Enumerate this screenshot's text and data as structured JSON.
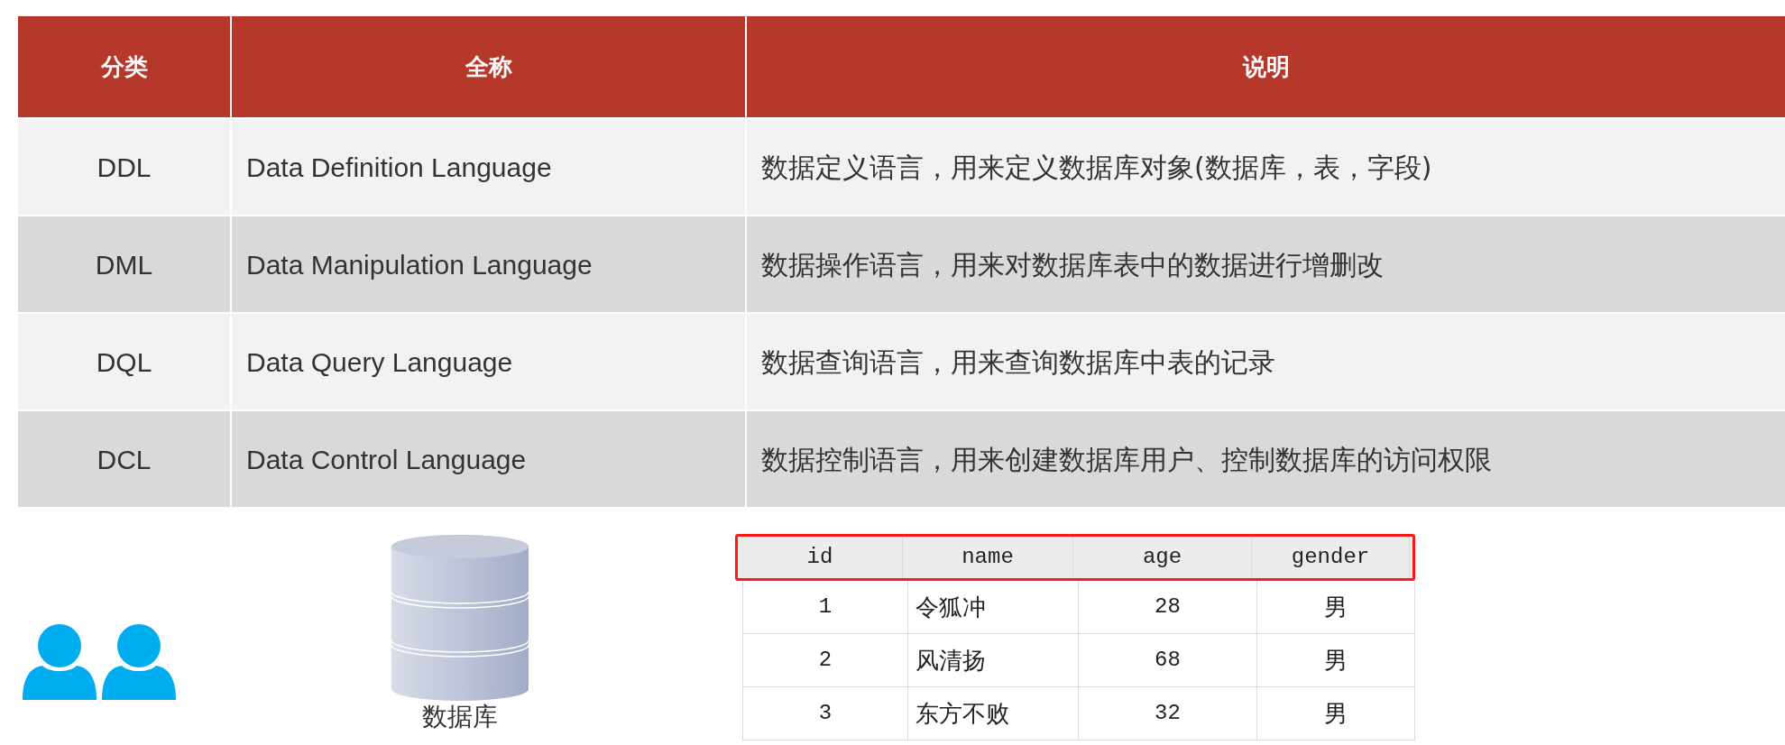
{
  "categories_table": {
    "columns": [
      "分类",
      "全称",
      "说明"
    ],
    "rows": [
      {
        "cells": [
          "DDL",
          "Data Definition Language",
          "数据定义语言，用来定义数据库对象(数据库，表，字段)"
        ]
      },
      {
        "cells": [
          "DML",
          "Data Manipulation Language",
          "数据操作语言，用来对数据库表中的数据进行增删改"
        ]
      },
      {
        "cells": [
          "DQL",
          "Data Query Language",
          "数据查询语言，用来查询数据库中表的记录"
        ]
      },
      {
        "cells": [
          "DCL",
          "Data Control Language",
          "数据控制语言，用来创建数据库用户、控制数据库的访问权限"
        ]
      }
    ]
  },
  "database": {
    "label": "数据库"
  },
  "records_table": {
    "columns": [
      "id",
      "name",
      "age",
      "gender"
    ],
    "rows": [
      {
        "cells": [
          "1",
          "令狐冲",
          "28",
          "男"
        ]
      },
      {
        "cells": [
          "2",
          "风清扬",
          "68",
          "男"
        ]
      },
      {
        "cells": [
          "3",
          "东方不败",
          "32",
          "男"
        ]
      }
    ]
  }
}
